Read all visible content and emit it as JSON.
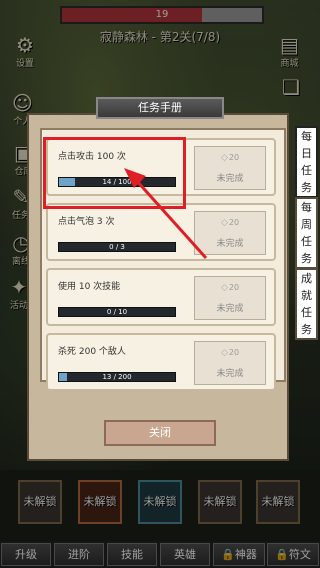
{
  "hud": {
    "hp_value": "19",
    "stage_title": "寂静森林 - 第2关(7/8)"
  },
  "side_left": [
    {
      "icon": "gear-icon",
      "label": "设置"
    },
    {
      "icon": "person-icon",
      "label": "个人"
    },
    {
      "icon": "chest-icon",
      "label": "仓库"
    },
    {
      "icon": "task-icon",
      "label": "任务"
    },
    {
      "icon": "clock-icon",
      "label": "离线"
    },
    {
      "icon": "gift-icon",
      "label": "活动"
    }
  ],
  "side_right": [
    {
      "icon": "treasure-chest-icon",
      "label": "商城"
    },
    {
      "icon": "scroll-icon",
      "label": ""
    }
  ],
  "modal": {
    "title": "任务手册",
    "close_label": "关闭",
    "tabs": [
      {
        "label": "每日任务",
        "lines": [
          "每",
          "日",
          "任",
          "务"
        ]
      },
      {
        "label": "每周任务",
        "lines": [
          "每",
          "周",
          "任",
          "务"
        ]
      },
      {
        "label": "成就任务",
        "lines": [
          "成",
          "就",
          "任",
          "务"
        ]
      }
    ],
    "tasks": [
      {
        "title": "点击攻击 100 次",
        "progress_text": "14 / 100",
        "progress": 0.14,
        "reward": "20",
        "status": "未完成"
      },
      {
        "title": "点击气泡 3 次",
        "progress_text": "0 / 3",
        "progress": 0,
        "reward": "20",
        "status": "未完成"
      },
      {
        "title": "使用 10 次技能",
        "progress_text": "0 / 10",
        "progress": 0,
        "reward": "20",
        "status": "未完成"
      },
      {
        "title": "杀死 200 个敌人",
        "progress_text": "13 / 200",
        "progress": 0.065,
        "reward": "20",
        "status": "未完成"
      }
    ]
  },
  "locked_slots": [
    {
      "label": "未解锁"
    },
    {
      "label": "未解锁"
    },
    {
      "label": "未解锁"
    },
    {
      "label": "未解锁"
    },
    {
      "label": "未解锁"
    }
  ],
  "bottom_tabs": [
    {
      "label": "升级",
      "locked": false
    },
    {
      "label": "进阶",
      "locked": false
    },
    {
      "label": "技能",
      "locked": false
    },
    {
      "label": "英雄",
      "locked": false
    },
    {
      "label": "神器",
      "locked": true
    },
    {
      "label": "符文",
      "locked": true
    }
  ],
  "colors": {
    "accent_red": "#e01e26",
    "progress_fill": "#6fa4c8"
  }
}
